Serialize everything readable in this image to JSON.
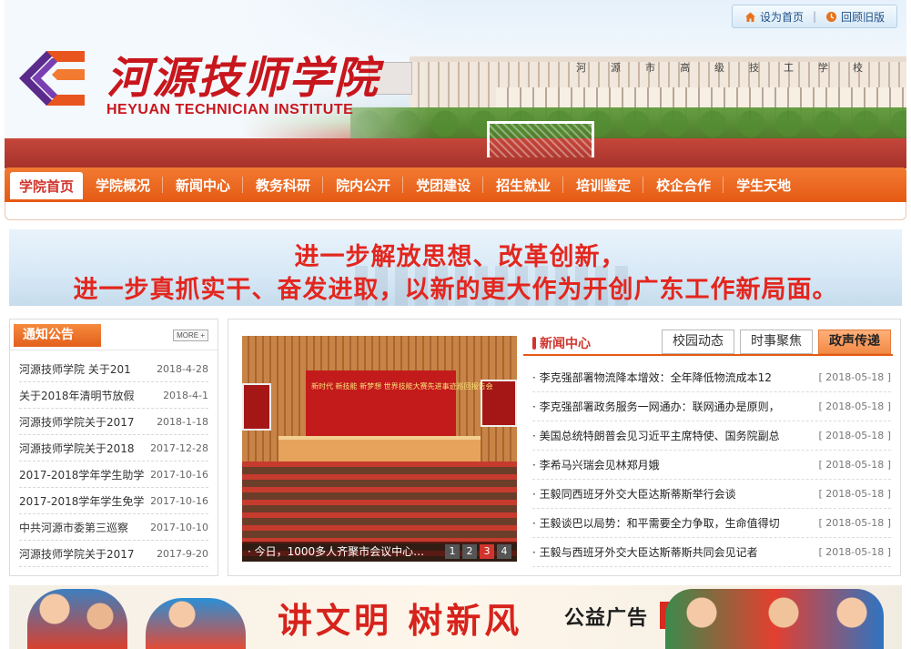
{
  "site": {
    "name_cn": "河源技师学院",
    "name_en": "HEYUAN TECHNICIAN INSTITUTE",
    "campus_sign": "河源市高级技工学校"
  },
  "top_links": [
    {
      "label": "设为首页",
      "icon": "home-icon"
    },
    {
      "label": "回顾旧版",
      "icon": "history-icon"
    }
  ],
  "nav": [
    {
      "label": "学院首页",
      "active": true
    },
    {
      "label": "学院概况"
    },
    {
      "label": "新闻中心"
    },
    {
      "label": "教务科研"
    },
    {
      "label": "院内公开"
    },
    {
      "label": "党团建设"
    },
    {
      "label": "招生就业"
    },
    {
      "label": "培训鉴定"
    },
    {
      "label": "校企合作"
    },
    {
      "label": "学生天地"
    }
  ],
  "banner": {
    "line1": "进一步解放思想、改革创新，",
    "line2": "进一步真抓实干、奋发进取，以新的更大作为开创广东工作新局面。"
  },
  "notice": {
    "title": "通知公告",
    "more": "MORE +",
    "items": [
      {
        "title": "河源技师学院 关于201",
        "date": "2018-4-28"
      },
      {
        "title": "关于2018年清明节放假",
        "date": "2018-4-1"
      },
      {
        "title": "河源技师学院关于2017",
        "date": "2018-1-18"
      },
      {
        "title": "河源技师学院关于2018",
        "date": "2017-12-28"
      },
      {
        "title": "2017-2018学年学生助学",
        "date": "2017-10-16"
      },
      {
        "title": "2017-2018学年学生免学",
        "date": "2017-10-16"
      },
      {
        "title": "中共河源市委第三巡察",
        "date": "2017-10-10"
      },
      {
        "title": "河源技师学院关于2017",
        "date": "2017-9-20"
      }
    ]
  },
  "photo": {
    "backdrop_text": "新时代 新技能 新梦想 世界技能大赛先进事迹巡回报告会",
    "caption": "今日，1000多人齐聚市会议中心…",
    "pages": [
      "1",
      "2",
      "3",
      "4"
    ],
    "current_page": "3"
  },
  "news": {
    "label": "新闻中心",
    "tabs": [
      {
        "label": "校园动态"
      },
      {
        "label": "时事聚焦"
      },
      {
        "label": "政声传递",
        "active": true
      }
    ],
    "items": [
      {
        "title": "李克强部署物流降本增效：全年降低物流成本12",
        "date": "[ 2018-05-18 ]"
      },
      {
        "title": "李克强部署政务服务一网通办：联网通办是原则，",
        "date": "[ 2018-05-18 ]"
      },
      {
        "title": "美国总统特朗普会见习近平主席特使、国务院副总",
        "date": "[ 2018-05-18 ]"
      },
      {
        "title": "李希马兴瑞会见林郑月娥",
        "date": "[ 2018-05-18 ]"
      },
      {
        "title": "王毅同西班牙外交大臣达斯蒂斯举行会谈",
        "date": "[ 2018-05-18 ]"
      },
      {
        "title": "王毅谈巴以局势：和平需要全力争取，生命值得切",
        "date": "[ 2018-05-18 ]"
      },
      {
        "title": "王毅与西班牙外交大臣达斯蒂斯共同会见记者",
        "date": "[ 2018-05-18 ]"
      }
    ]
  },
  "public_ad": {
    "slogan": "讲文明 树新风",
    "tag": "公益广告"
  }
}
